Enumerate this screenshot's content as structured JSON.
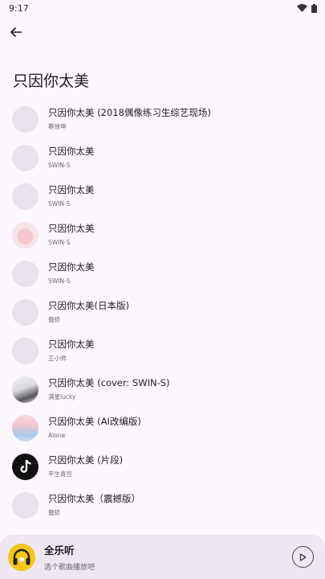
{
  "status_bar": {
    "time": "9:17",
    "wifi_icon": "wifi-icon",
    "battery_icon": "battery-icon"
  },
  "header": {
    "back_icon": "arrow-left-icon",
    "title": "只因你太美"
  },
  "songs": [
    {
      "title": "只因你太美 (2018偶像练习生综艺现场)",
      "artist": "蔡徐坤",
      "cover": "placeholder"
    },
    {
      "title": "只因你太美",
      "artist": "SWIN-S",
      "cover": "placeholder"
    },
    {
      "title": "只因你太美",
      "artist": "SWIN-S",
      "cover": "placeholder"
    },
    {
      "title": "只因你太美",
      "artist": "SWIN-S",
      "cover": "pink-group-photo"
    },
    {
      "title": "只因你太美",
      "artist": "SWIN-S",
      "cover": "placeholder"
    },
    {
      "title": "只因你太美(日本版)",
      "artist": "傲骄",
      "cover": "placeholder"
    },
    {
      "title": "只因你太美",
      "artist": "王小帅",
      "cover": "placeholder"
    },
    {
      "title": "只因你太美 (cover: SWIN-S)",
      "artist": "满星lucky",
      "cover": "person-photo"
    },
    {
      "title": "只因你太美 (AI改编版)",
      "artist": "Alone",
      "cover": "pastel-photo"
    },
    {
      "title": "只因你太美 (片段)",
      "artist": "平生青豆",
      "cover": "tiktok-logo"
    },
    {
      "title": "只因你太美（震撼版）",
      "artist": "傲骄",
      "cover": "placeholder"
    }
  ],
  "player": {
    "name": "全乐听",
    "subtitle": "选个歌曲播放吧",
    "art_icon": "headphones-icon",
    "play_icon": "play-icon"
  },
  "colors": {
    "background": "#fdf7fe",
    "placeholder": "#e8e2ec",
    "player_bar": "#efe7f2",
    "player_art": "#f5c518"
  }
}
